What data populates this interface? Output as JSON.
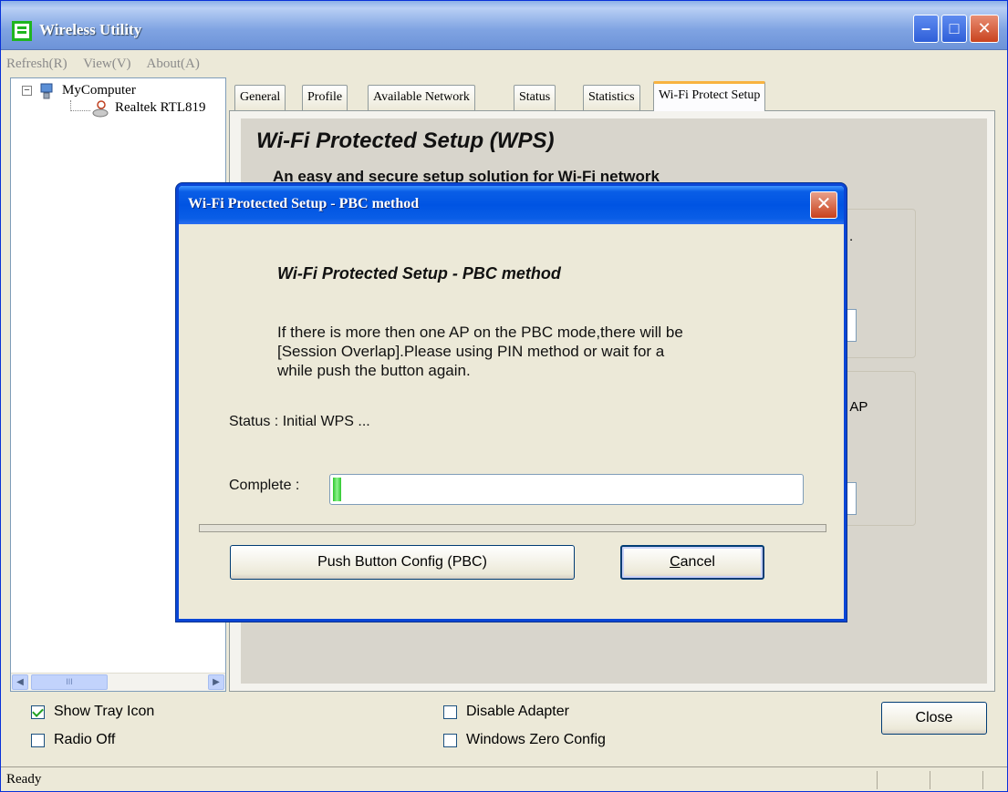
{
  "window": {
    "title": "Wireless Utility",
    "menu": [
      "Refresh(R)",
      "View(V)",
      "About(A)"
    ]
  },
  "tree": {
    "root_label": "MyComputer",
    "adapter_label": "Realtek RTL819",
    "expander": "−",
    "scroll_thumb_mark": "III"
  },
  "tabs": [
    {
      "label": "General"
    },
    {
      "label": "Profile"
    },
    {
      "label": "Available Network"
    },
    {
      "label": "Status"
    },
    {
      "label": "Statistics"
    },
    {
      "label": "Wi-Fi Protect Setup"
    }
  ],
  "active_tab": "Wi-Fi Protect Setup",
  "wps_panel": {
    "heading": "Wi-Fi Protected Setup (WPS)",
    "subheading": "An easy and secure setup solution for Wi-Fi network",
    "partial_text_pin": ".",
    "partial_text_pbc": "r AP"
  },
  "bottom": {
    "show_tray_icon": {
      "label": "Show Tray Icon",
      "checked": true
    },
    "radio_off": {
      "label": "Radio Off",
      "checked": false
    },
    "disable_adapter": {
      "label": "Disable Adapter",
      "checked": false
    },
    "windows_zero_config": {
      "label": "Windows Zero Config",
      "checked": false
    },
    "close_label": "Close"
  },
  "statusbar": {
    "text": "Ready"
  },
  "dialog": {
    "title": "Wi-Fi Protected Setup - PBC method",
    "heading": "Wi-Fi Protected Setup - PBC method",
    "message": "If there is more then one AP on the PBC mode,there will be\n[Session Overlap].Please using PIN method or wait for a\nwhile push the button again.",
    "status_text": "Status : Initial WPS ...",
    "complete_label": "Complete :",
    "progress_fraction": 0.018,
    "pbc_button_label": "Push Button Config (PBC)",
    "cancel_label_first": "C",
    "cancel_label_rest": "ancel",
    "close_glyph": "✕"
  },
  "colors": {
    "progress_green": "#2ec82e",
    "xp_title_blue": "#0054e3",
    "close_red": "#c8401c"
  }
}
